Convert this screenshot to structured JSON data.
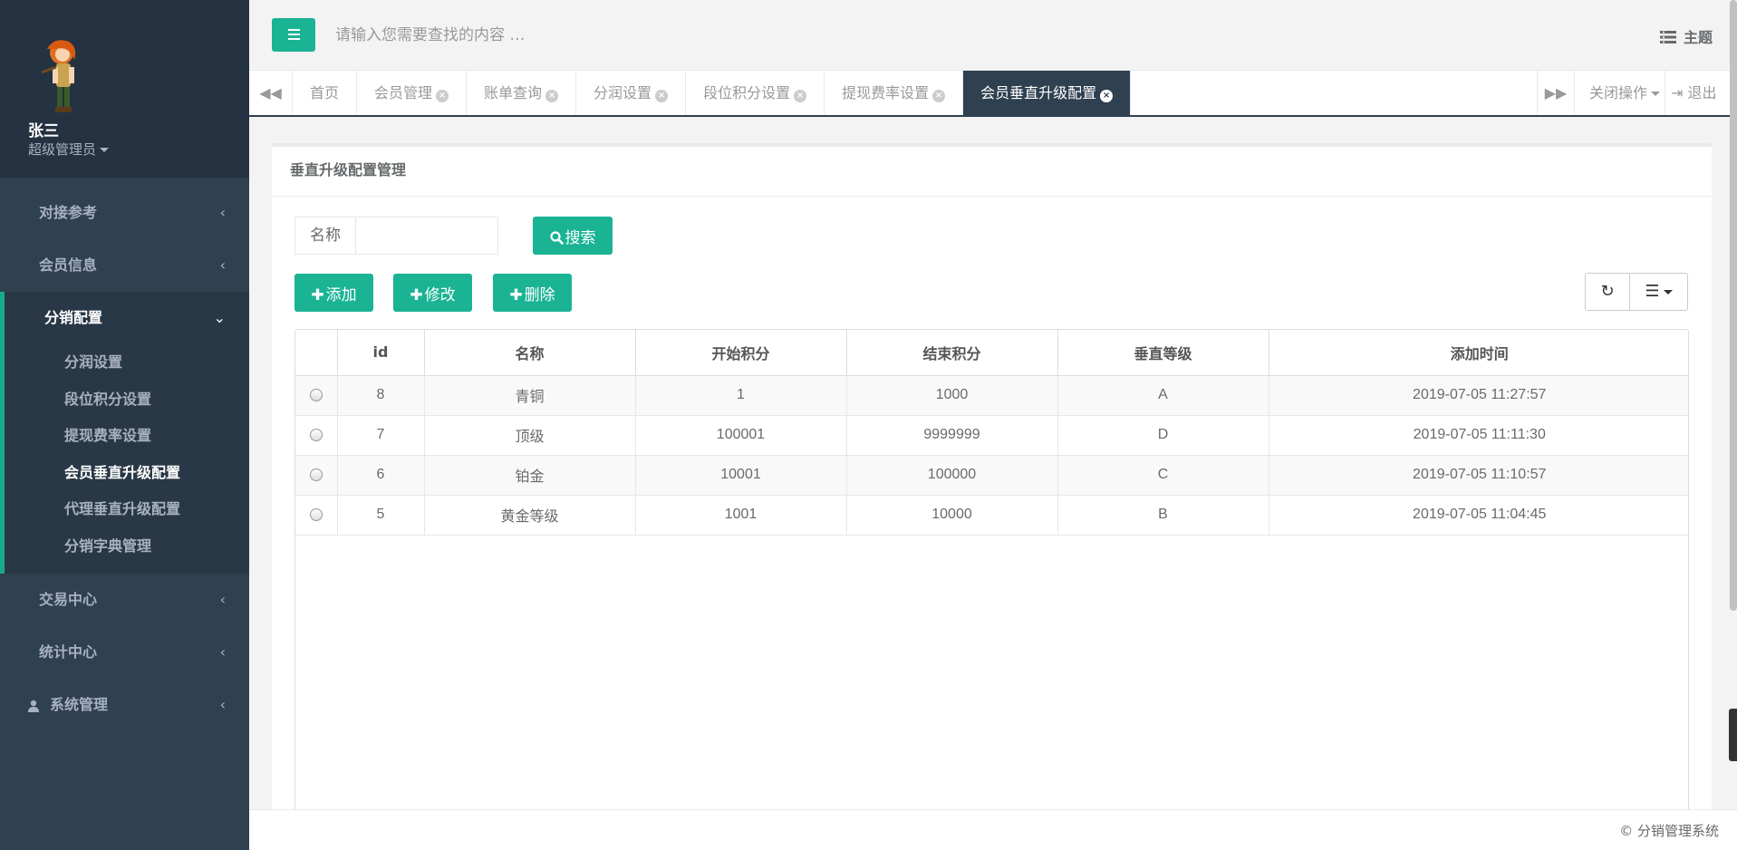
{
  "user": {
    "name": "张三",
    "role": "超级管理员"
  },
  "sidebar": {
    "items_top": [
      {
        "label": "对接参考"
      },
      {
        "label": "会员信息"
      }
    ],
    "open_group": {
      "label": "分销配置",
      "children": [
        {
          "label": "分润设置"
        },
        {
          "label": "段位积分设置"
        },
        {
          "label": "提现费率设置"
        },
        {
          "label": "会员垂直升级配置",
          "active": true
        },
        {
          "label": "代理垂直升级配置"
        },
        {
          "label": "分销字典管理"
        }
      ]
    },
    "items_bottom": [
      {
        "label": "交易中心"
      },
      {
        "label": "统计中心"
      },
      {
        "label": "系统管理"
      }
    ]
  },
  "header": {
    "search_placeholder": "请输入您需要查找的内容 …",
    "theme_label": "主题"
  },
  "tabs": [
    {
      "label": "首页",
      "closable": false
    },
    {
      "label": "会员管理",
      "closable": true
    },
    {
      "label": "账单查询",
      "closable": true
    },
    {
      "label": "分润设置",
      "closable": true
    },
    {
      "label": "段位积分设置",
      "closable": true
    },
    {
      "label": "提现费率设置",
      "closable": true
    },
    {
      "label": "会员垂直升级配置",
      "closable": true,
      "active": true
    }
  ],
  "tabbar": {
    "close_ops_label": "关闭操作",
    "logout_label": "退出"
  },
  "panel": {
    "title": "垂直升级配置管理",
    "filter_label": "名称",
    "filter_value": "",
    "search_button": "搜索",
    "add_button": "添加",
    "edit_button": "修改",
    "delete_button": "删除"
  },
  "table": {
    "columns": [
      "id",
      "名称",
      "开始积分",
      "结束积分",
      "垂直等级",
      "添加时间"
    ],
    "rows": [
      {
        "id": "8",
        "name": "青铜",
        "start": "1",
        "end": "1000",
        "level": "A",
        "time": "2019-07-05 11:27:57"
      },
      {
        "id": "7",
        "name": "顶级",
        "start": "100001",
        "end": "9999999",
        "level": "D",
        "time": "2019-07-05 11:11:30"
      },
      {
        "id": "6",
        "name": "铂金",
        "start": "10001",
        "end": "100000",
        "level": "C",
        "time": "2019-07-05 11:10:57"
      },
      {
        "id": "5",
        "name": "黄金等级",
        "start": "1001",
        "end": "10000",
        "level": "B",
        "time": "2019-07-05 11:04:45"
      }
    ]
  },
  "footer": {
    "text": "© 分销管理系统"
  },
  "colors": {
    "sidebar_bg": "#2f4050",
    "accent": "#1ab394",
    "active_border": "#19aa8d"
  },
  "icons": [
    "hamburger-icon",
    "theme-icon",
    "backward-icon",
    "forward-icon",
    "close-circle-icon",
    "logout-icon",
    "search-icon",
    "plus-icon",
    "refresh-icon",
    "list-icon",
    "user-icon",
    "chevron-left-icon",
    "chevron-down-icon"
  ]
}
